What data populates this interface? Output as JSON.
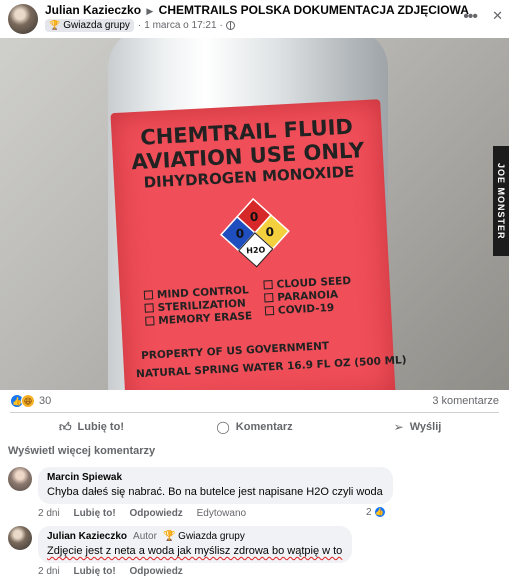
{
  "post": {
    "author": "Julian Kazieczko",
    "group": "CHEMTRAILS POLSKA DOKUMENTACJA ZDJĘCIOWA",
    "badge": "Gwiazda grupy",
    "time": "1 marca o 17:21",
    "menu_icon": "more-horizontal-icon"
  },
  "photo": {
    "label_line1": "CHEMTRAIL FLUID",
    "label_line2": "AVIATION USE ONLY",
    "label_line3": "DIHYDROGEN MONOXIDE",
    "diamond_top": "0",
    "diamond_left": "0",
    "diamond_right": "0",
    "diamond_bottom": "H2O",
    "checklist_left": [
      "MIND CONTROL",
      "STERILIZATION",
      "MEMORY ERASE"
    ],
    "checklist_right": [
      "CLOUD SEED",
      "PARANOIA",
      "COVID-19"
    ],
    "property": "PROPERTY OF US GOVERNMENT",
    "water": "NATURAL SPRING WATER 16.9 FL OZ (500 ML)",
    "watermark": "JOE MONSTER"
  },
  "stats": {
    "reactions": "30",
    "comments": "3 komentarze"
  },
  "actions": {
    "like": "Lubię to!",
    "comment": "Komentarz",
    "share": "Wyślij"
  },
  "more_comments": "Wyświetl więcej komentarzy",
  "comments": [
    {
      "author": "Marcin Spiewak",
      "text": "Chyba dałeś się nabrać. Bo na butelce jest napisane H2O czyli woda",
      "time": "2 dni",
      "like": "Lubię to!",
      "reply": "Odpowiedz",
      "edited": "Edytowano",
      "likes": "2"
    },
    {
      "author": "Julian Kazieczko",
      "role": "Autor",
      "badge": "Gwiazda grupy",
      "text": "Zdjęcie jest z neta a woda jak myślisz zdrowa bo wątpię w to",
      "time": "2 dni",
      "like": "Lubię to!",
      "reply": "Odpowiedz"
    }
  ],
  "colors": {
    "like_blue": "#1877f2",
    "label_red": "#f04e58",
    "muted": "#65676b",
    "bubble": "#f0f2f5"
  }
}
